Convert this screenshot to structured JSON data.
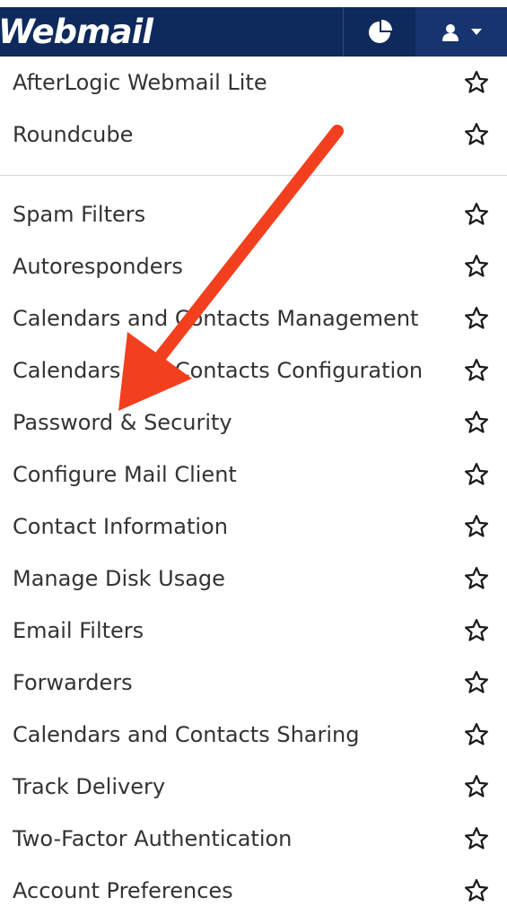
{
  "header": {
    "logo_text": "Webmail",
    "stats_icon": "pie-chart-icon",
    "user_icon": "user-icon",
    "dropdown_icon": "caret-down-icon",
    "bg_color": "#0e2a5c"
  },
  "menu": {
    "group1": [
      {
        "label": "AfterLogic Webmail Lite"
      },
      {
        "label": "Roundcube"
      }
    ],
    "group2": [
      {
        "label": "Spam Filters"
      },
      {
        "label": "Autoresponders"
      },
      {
        "label": "Calendars and Contacts Management"
      },
      {
        "label": "Calendars and Contacts Configuration"
      },
      {
        "label": "Password & Security"
      },
      {
        "label": "Configure Mail Client"
      },
      {
        "label": "Contact Information"
      },
      {
        "label": "Manage Disk Usage"
      },
      {
        "label": "Email Filters"
      },
      {
        "label": "Forwarders"
      },
      {
        "label": "Calendars and Contacts Sharing"
      },
      {
        "label": "Track Delivery"
      },
      {
        "label": "Two-Factor Authentication"
      },
      {
        "label": "Account Preferences"
      }
    ],
    "favorite_icon": "star-outline-icon"
  },
  "annotation": {
    "icon": "red-arrow-icon",
    "color": "#f2401f"
  }
}
